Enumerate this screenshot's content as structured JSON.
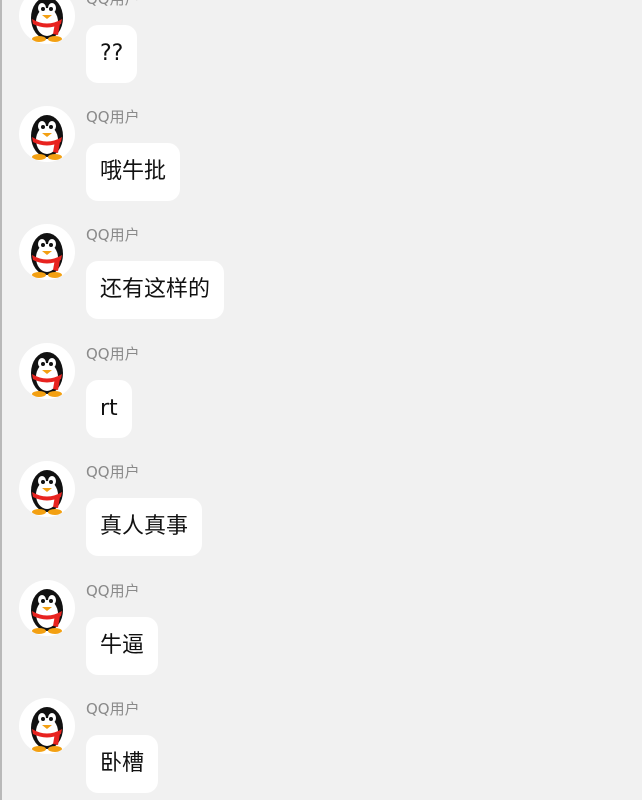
{
  "chat": {
    "messages": [
      {
        "username": "QQ用户",
        "text": "??"
      },
      {
        "username": "QQ用户",
        "text": "哦牛批"
      },
      {
        "username": "QQ用户",
        "text": "还有这样的"
      },
      {
        "username": "QQ用户",
        "text": "rt"
      },
      {
        "username": "QQ用户",
        "text": "真人真事"
      },
      {
        "username": "QQ用户",
        "text": "牛逼"
      },
      {
        "username": "QQ用户",
        "text": "卧槽"
      }
    ]
  },
  "colors": {
    "background": "#f1f1f1",
    "bubble": "#ffffff",
    "username": "#8a8a8a",
    "text": "#111111",
    "scarf": "#e8231f"
  },
  "icons": {
    "avatar": "qq-penguin-avatar-icon"
  }
}
